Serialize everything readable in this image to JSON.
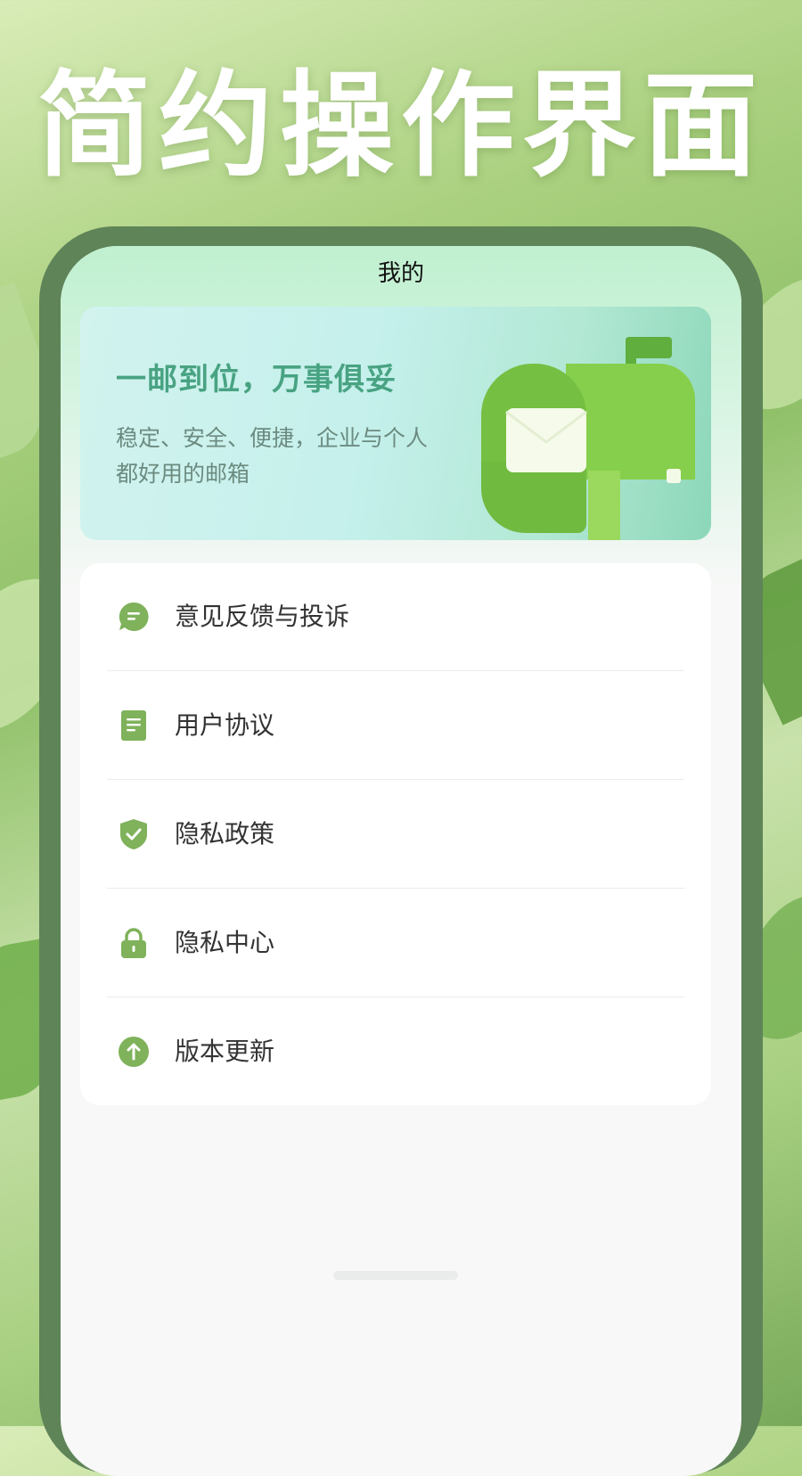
{
  "hero": {
    "title": "简约操作界面"
  },
  "screen": {
    "nav_title": "我的",
    "banner": {
      "headline": "一邮到位，万事俱妥",
      "subtitle": "稳定、安全、便捷，企业与个人都好用的邮箱"
    },
    "menu": [
      {
        "label": "意见反馈与投诉",
        "icon": "chat-bubble-icon"
      },
      {
        "label": "用户协议",
        "icon": "document-icon"
      },
      {
        "label": "隐私政策",
        "icon": "shield-check-icon"
      },
      {
        "label": "隐私中心",
        "icon": "lock-icon"
      },
      {
        "label": "版本更新",
        "icon": "upload-arrow-icon"
      }
    ]
  },
  "colors": {
    "accent": "#7fb25b",
    "banner_text": "#48a382",
    "phone_frame": "#5f8458"
  }
}
